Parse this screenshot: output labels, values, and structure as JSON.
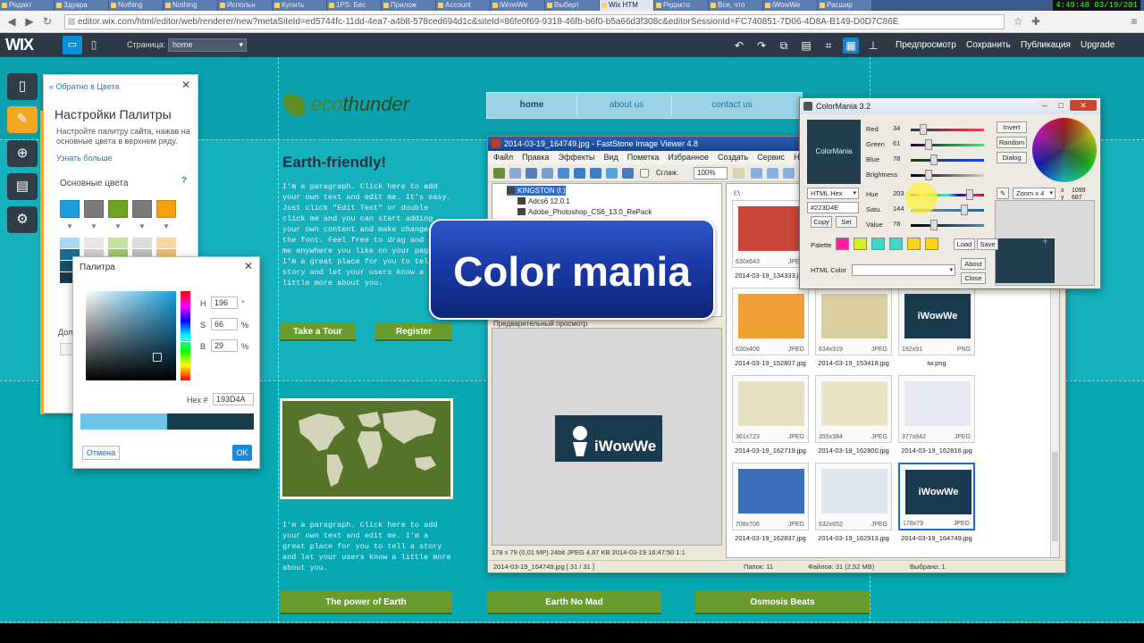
{
  "browser": {
    "tabs": [
      "Редакт",
      "Здуара",
      "Nothing",
      "Nothing",
      "Испольн",
      "Купить",
      "1PS: Бес",
      "Прилож",
      "Account",
      "iWowWe",
      "Выберт",
      "Wix HTM",
      "Редакто",
      "Все, что",
      "iWowWe",
      "Расшир"
    ],
    "active_tab_index": 11,
    "clock": "4:49:48 03/19/201",
    "url": "editor.wix.com/html/editor/web/renderer/new?metaSiteId=ed5744fc-11dd-4ea7-a4b8-578ced694d1c&siteId=86fe0f69-9318-46fb-b6f0-b5a66d3f308c&editorSessionId=FC740851-7D06-4D8A-B149-D0D7C86E",
    "nav_back_icon": "back-icon",
    "nav_forward_icon": "forward-icon",
    "reload_icon": "reload-icon",
    "star_icon": "star-icon",
    "menu_icon": "menu-icon"
  },
  "wix": {
    "logo": "WIX",
    "page_label": "Страница:",
    "page_value": "home",
    "preview": "Предпросмотр",
    "save": "Сохранить",
    "publish": "Публикация",
    "upgrade": "Upgrade"
  },
  "palette_panel": {
    "back": "« Обратно в Цвета",
    "title": "Настройки Палитры",
    "description": "Настройте палитру сайта, нажав на основные цвета в верхнем ряду.",
    "learn_more": "Узнать больше",
    "section": "Основные цвета",
    "help": "?",
    "dont_label": "Дол",
    "main_colors": [
      "#1a9fdc",
      "#7a7a7a",
      "#6fa322",
      "#7a7a7a",
      "#f5a00f"
    ],
    "grid_colors": [
      [
        "#a9d9ef",
        "#e6e6e6",
        "#c7e0a5",
        "#dcdcdc",
        "#f9d7a2"
      ],
      [
        "#1b6d94",
        "#cfcfcf",
        "#9fc76b",
        "#bdbdbd",
        "#f3bb66"
      ],
      [
        "#1b4f6a",
        "#a8a8a8",
        "#6f9f34",
        "#9a9a9a",
        "#d28a1c"
      ],
      [
        "#163b4d",
        "#6e6e6e",
        "#4d7620",
        "#6e6e6e",
        "#9d6410"
      ]
    ]
  },
  "picker": {
    "title": "Палитра",
    "h_label": "H",
    "h_value": "196",
    "h_unit": "°",
    "s_label": "S",
    "s_value": "66",
    "s_unit": "%",
    "b_label": "B",
    "b_value": "29",
    "b_unit": "%",
    "hex_label": "Hex #",
    "hex_value": "193D4A",
    "old_color": "#6ec4e8",
    "new_color": "#193d4a",
    "cancel": "Отмена",
    "ok": "OK"
  },
  "site": {
    "logo_eco": "eco",
    "logo_thunder": "thunder",
    "nav": [
      "home",
      "about us",
      "contact us"
    ],
    "heading": "Earth-friendly!",
    "para1": "I'm a paragraph. Click here to add your own text and edit me. It's easy. Just click \"Edit Text\" or double click me and you can start adding your own content and make changes to the font. Feel free to drag and drop me anywhere you like on your page. I'm a great place for you to tell a story and let your users know a little more about you.",
    "btn_tour": "Take a Tour",
    "btn_register": "Register",
    "para2": "I'm a paragraph. Click here to add your own text and edit me. I'm a great place for you to tell a story and let your users know a little more about you.",
    "footer_buttons": [
      "The power of Earth",
      "Earth No Mad",
      "Osmosis Beats"
    ]
  },
  "faststone": {
    "title": "2014-03-19_164749.jpg - FastStone Image Viewer 4.8",
    "menu": [
      "Файл",
      "Правка",
      "Эффекты",
      "Вид",
      "Пометка",
      "Избранное",
      "Создать",
      "Сервис",
      "Настро"
    ],
    "smooth_label": "Сглаж.",
    "zoom": "100%",
    "tree": [
      "KINGSTON (I:)",
      "Adcs6 12.0.1",
      "Adobe_Photoshop_CS6_13.0_RePack"
    ],
    "tree_selected_index": 0,
    "folder_label": "I:\\",
    "preview_label": "Предварительный просмотр",
    "preview_brand": "iWowWe",
    "status_info": "178 x 79 (0,01 MP)  24bit  JPEG  4,87 KB  2014-03-19 16:47:50  1:1",
    "status_file": "2014-03-19_164749.jpg [ 31 / 31 ]",
    "status_count": "Папок: 11",
    "status_files": "Файлов: 31 (2,52 MB)",
    "status_selected": "Выбрано: 1",
    "thumbs": [
      {
        "size": "630x643",
        "type": "JPEG",
        "name": "2014-03-19_134333.jpg",
        "color": "#c9473a",
        "selected": false
      },
      {
        "size": "",
        "type": "",
        "name": "",
        "color": "#ffffff",
        "selected": false
      },
      {
        "size": "",
        "type": "",
        "name": "",
        "color": "#ffffff",
        "selected": false
      },
      {
        "size": "630x409",
        "type": "JPEG",
        "name": "2014-03-19_152807.jpg",
        "color": "#f0a036",
        "selected": false
      },
      {
        "size": "634x319",
        "type": "JPEG",
        "name": "2014-03-19_153418.jpg",
        "color": "#d9cfa0",
        "selected": false
      },
      {
        "size": "192x91",
        "type": "PNG",
        "name": "iw.png",
        "color": "#1a3a4d",
        "selected": false
      },
      {
        "size": "361x723",
        "type": "JPEG",
        "name": "2014-03-19_162719.jpg",
        "color": "#e4e0c4",
        "selected": false
      },
      {
        "size": "355x384",
        "type": "JPEG",
        "name": "2014-03-19_162800.jpg",
        "color": "#e9e3c8",
        "selected": false
      },
      {
        "size": "377x842",
        "type": "JPEG",
        "name": "2014-03-19_162816.jpg",
        "color": "#e8e8f0",
        "selected": false
      },
      {
        "size": "708x706",
        "type": "JPEG",
        "name": "2014-03-19_162837.jpg",
        "color": "#3d6fb8",
        "selected": false
      },
      {
        "size": "632x652",
        "type": "JPEG",
        "name": "2014-03-19_162913.jpg",
        "color": "#dfe6ee",
        "selected": false
      },
      {
        "size": "178x79",
        "type": "JPEG",
        "name": "2014-03-19_164749.jpg",
        "color": "#1a3a4d",
        "selected": true
      }
    ],
    "iw_label": "iWowWe"
  },
  "banner": {
    "text": "Color mania"
  },
  "colormania": {
    "title": "ColorMania 3.2",
    "preview_text": "ColorMania",
    "red_label": "Red",
    "red_value": "34",
    "green_label": "Green",
    "green_value": "61",
    "blue_label": "Blue",
    "blue_value": "78",
    "brightness_label": "Brightness",
    "hue_label": "Hue",
    "hue_value": "203",
    "sat_label": "Satu.",
    "sat_value": "144",
    "value_label": "Value",
    "value_value": "78",
    "format": "HTML Hex",
    "hex": "#223D4E",
    "copy": "Copy",
    "set": "Set",
    "invert": "Invert",
    "random": "Random",
    "dialog": "Dialog",
    "zoom": "Zoom x 4",
    "x_label": "x",
    "x_value": "1099",
    "y_label": "y",
    "y_value": "687",
    "palette_label": "Palette",
    "palette_colors": [
      "#ff1fa0",
      "#d7ef2a",
      "#3fd6c8",
      "#3fd6c8",
      "#ffd21a",
      "#ffd21a"
    ],
    "load": "Load",
    "save": "Save",
    "html_color_label": "HTML Color",
    "about": "About",
    "close": "Close"
  }
}
